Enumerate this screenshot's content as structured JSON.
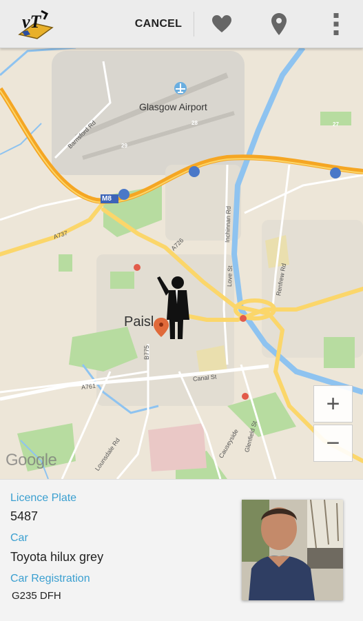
{
  "actionbar": {
    "cancel_label": "CANCEL",
    "icons": [
      "app-logo",
      "heart-icon",
      "map-pin-icon",
      "overflow-menu-icon"
    ]
  },
  "map": {
    "place_labels": {
      "airport": "Glasgow Airport",
      "town": "Paisley"
    },
    "road_labels": {
      "barnsford": "Barnsford Rd",
      "m8": "M8",
      "a737": "A737",
      "a726": "A726",
      "inchinnan": "Inchinnan Rd",
      "love_st": "Love St",
      "renfrew": "Renfrew Rd",
      "b775": "B775",
      "a761": "A761",
      "canal_st": "Canal St",
      "lounsdale": "Lounsdale Rd",
      "causeyside": "Causeyside",
      "glenfield": "Glenfield St"
    },
    "junctions": [
      "29",
      "28",
      "27"
    ],
    "zoom_in": "+",
    "zoom_out": "−",
    "attribution": "Google",
    "colors": {
      "land": "#ede6d8",
      "motorway": "#f5a623",
      "major_road": "#fbd66a",
      "water": "#8ec3f0",
      "park": "#b7dca0"
    }
  },
  "driver": {
    "licence_plate_label": "Licence Plate",
    "licence_plate": "5487",
    "car_label": "Car",
    "car": "Toyota hilux grey",
    "registration_label": "Car Registration",
    "registration": "G235 DFH"
  }
}
